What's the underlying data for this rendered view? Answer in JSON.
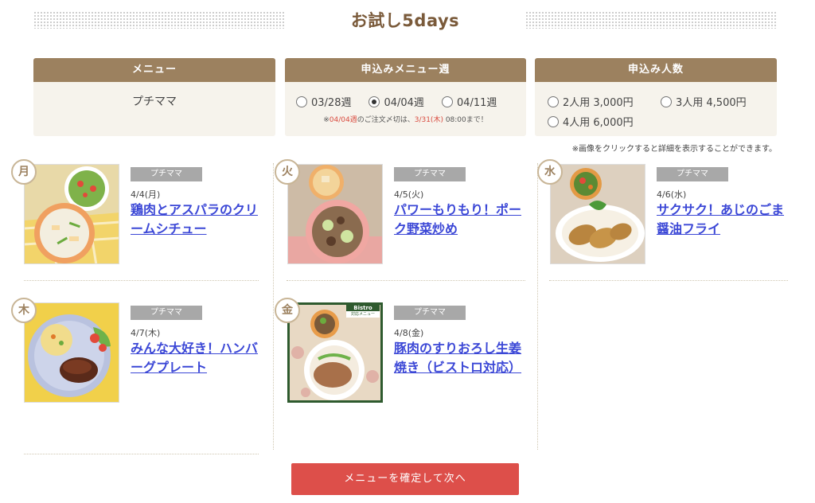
{
  "title": "お試し5days",
  "selectors": {
    "menu": {
      "header": "メニュー",
      "value": "プチママ"
    },
    "week": {
      "header": "申込みメニュー週",
      "options": [
        "03/28週",
        "04/04週",
        "04/11週"
      ],
      "selected": "04/04週",
      "note_prefix": "※",
      "note_week": "04/04週",
      "note_mid": "のご注文〆切は、",
      "note_date": "3/31(木)",
      "note_suffix": " 08:00まで！"
    },
    "servings": {
      "header": "申込み人数",
      "options": [
        "2人用 3,000円",
        "3人用 4,500円",
        "4人用 6,000円"
      ]
    }
  },
  "caption": "※画像をクリックすると詳細を表示することができます。",
  "menus": [
    {
      "day": "月",
      "tag": "プチママ",
      "date": "4/4(月)",
      "name": "鶏肉とアスパラのクリームシチュー"
    },
    {
      "day": "火",
      "tag": "プチママ",
      "date": "4/5(火)",
      "name": "パワーもりもり！ポーク野菜炒め"
    },
    {
      "day": "水",
      "tag": "プチママ",
      "date": "4/6(水)",
      "name": "サクサク！あじのごま醤油フライ"
    },
    {
      "day": "木",
      "tag": "プチママ",
      "date": "4/7(木)",
      "name": "みんな大好き！ハンバーグプレート"
    },
    {
      "day": "金",
      "tag": "プチママ",
      "date": "4/8(金)",
      "name": "豚肉のすりおろし生姜焼き（ビストロ対応）",
      "badge_title": "Bistro",
      "badge_sub": "対応メニュー"
    }
  ],
  "confirm_button": "メニューを確定して次へ",
  "colors": {
    "accent": "#9c815f",
    "button": "#dd4f4a",
    "link": "#3b47d6"
  }
}
